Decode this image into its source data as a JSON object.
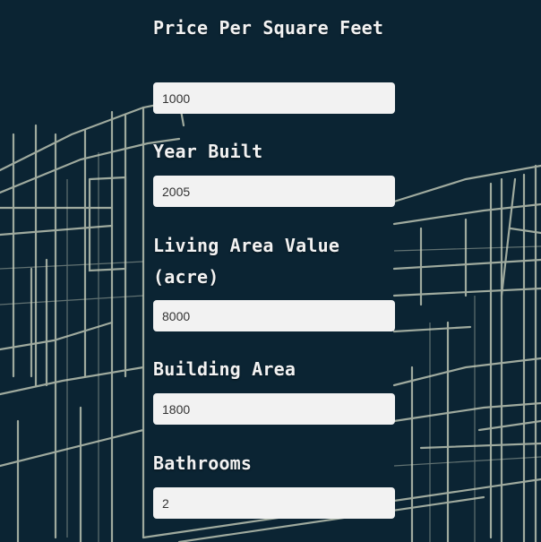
{
  "form": {
    "fields": [
      {
        "label": "Price Per Square Feet",
        "value": "1000"
      },
      {
        "label": "Year Built",
        "value": "2005"
      },
      {
        "label": "Living Area Value (acre)",
        "value": "8000"
      },
      {
        "label": "Building Area",
        "value": "1800"
      },
      {
        "label": "Bathrooms",
        "value": "2"
      }
    ]
  },
  "colors": {
    "background": "#0b2433",
    "sketch_lines": "#c9d0bc",
    "input_background": "#f2f2f2",
    "label_text": "#f2f2f2"
  }
}
